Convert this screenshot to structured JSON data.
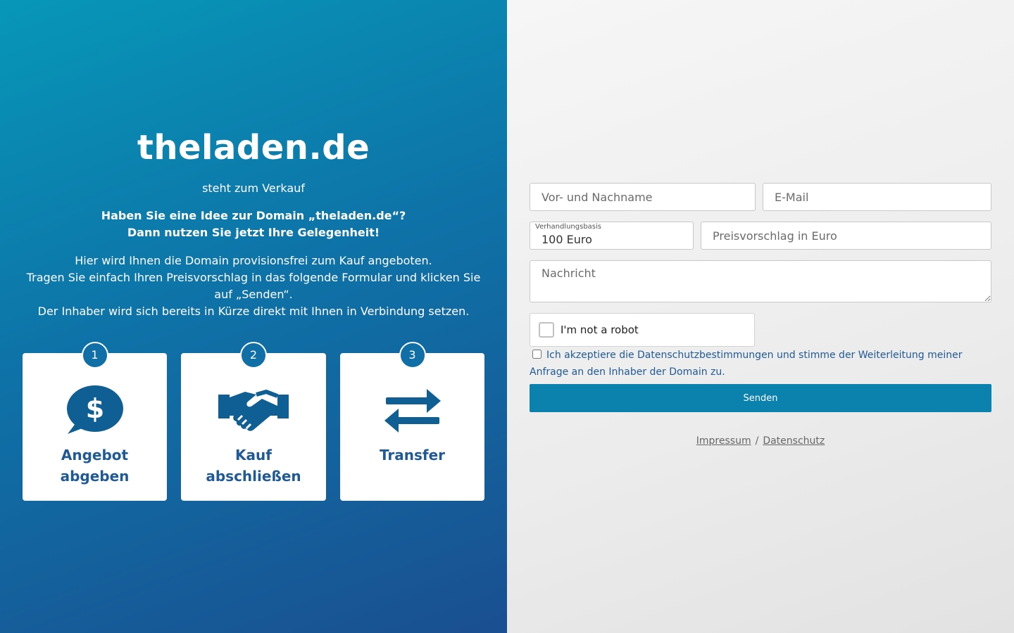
{
  "hero": {
    "domain": "theladen.de",
    "subtitle": "steht zum Verkauf",
    "headline_1": "Haben Sie eine Idee zur Domain „theladen.de“?",
    "headline_2": "Dann nutzen Sie jetzt Ihre Gelegenheit!",
    "intro_1": "Hier wird Ihnen die Domain provisionsfrei zum Kauf angeboten.",
    "intro_2": "Tragen Sie einfach Ihren Preisvorschlag in das folgende Formular und klicken Sie auf „Senden“.",
    "intro_3": "Der Inhaber wird sich bereits in Kürze direkt mit Ihnen in Verbindung setzen."
  },
  "steps": [
    {
      "number": "1",
      "label_1": "Angebot",
      "label_2": "abgeben",
      "icon": "dollar-speech-bubble-icon"
    },
    {
      "number": "2",
      "label_1": "Kauf",
      "label_2": "abschließen",
      "icon": "handshake-icon"
    },
    {
      "number": "3",
      "label_1": "Transfer",
      "label_2": "",
      "icon": "transfer-arrows-icon"
    }
  ],
  "form": {
    "name_placeholder": "Vor- und Nachname",
    "email_placeholder": "E-Mail",
    "negotiation_label": "Verhandlungsbasis",
    "negotiation_value": "100 Euro",
    "price_placeholder": "Preisvorschlag in Euro",
    "message_placeholder": "Nachricht",
    "captcha_label": "I'm not a robot",
    "consent_text": "Ich akzeptiere die Datenschutzbestimmungen und stimme der Weiterleitung meiner Anfrage an den Inhaber der Domain zu.",
    "submit_label": "Senden"
  },
  "footer": {
    "imprint": "Impressum",
    "separator": "/",
    "privacy": "Datenschutz"
  },
  "colors": {
    "gradient_start": "#0797b8",
    "gradient_end": "#1a4f91",
    "accent": "#0b82ad",
    "step_text": "#1f5a96"
  }
}
